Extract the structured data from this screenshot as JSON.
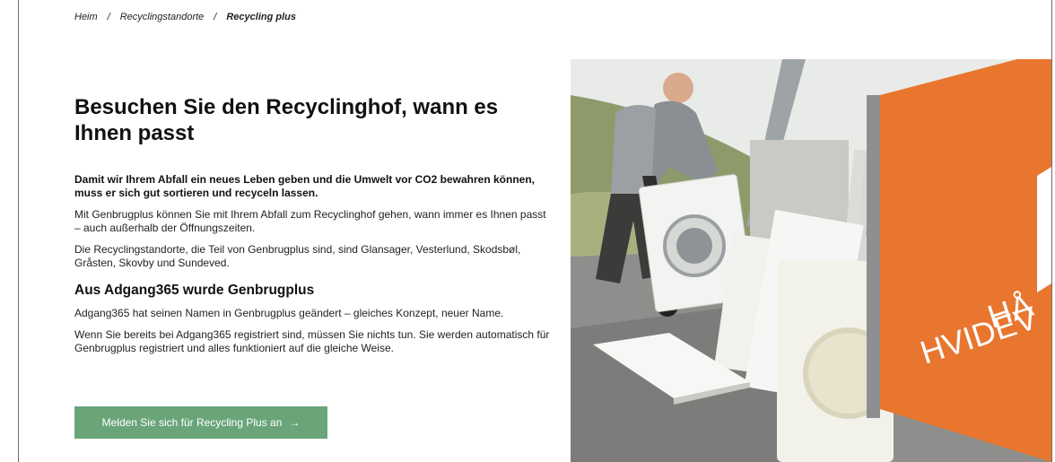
{
  "breadcrumb": {
    "items": [
      "Heim",
      "Recyclingstandorte"
    ],
    "separator": "/",
    "current": "Recycling plus"
  },
  "hero": {
    "title": "Besuchen Sie den Recyclinghof, wann es Ihnen passt",
    "lead": "Damit wir Ihrem Abfall ein neues Leben geben und die Umwelt vor CO2 bewahren können, muss er sich gut sortieren und recyceln lassen.",
    "paragraph1": "Mit Genbrugplus können Sie mit Ihrem Abfall zum Recyclinghof gehen, wann immer es Ihnen passt – auch außerhalb der Öffnungszeiten.",
    "paragraph2": "Die Recyclingstandorte, die Teil von Genbrugplus sind, sind Glansager, Vesterlund, Skodsbøl, Gråsten, Skovby und Sundeved.",
    "subheading": "Aus Adgang365 wurde Genbrugplus",
    "paragraph3": "Adgang365 hat seinen Namen in Genbrugplus geändert – gleiches Konzept, neuer Name.",
    "paragraph4": "Wenn Sie bereits bei Adgang365 registriert sind, müssen Sie nichts tun. Sie werden automatisch für Genbrugplus registriert und alles funktioniert auf die gleiche Weise.",
    "cta_label": "Melden Sie sich für Recycling Plus an",
    "cta_arrow": "→"
  },
  "photo": {
    "sign_text_line1": "HÅ",
    "sign_text_line2": "HVIDEV"
  },
  "colors": {
    "cta_background": "#6aa57a",
    "cta_text": "#ffffff",
    "sign_orange": "#e8762e"
  }
}
